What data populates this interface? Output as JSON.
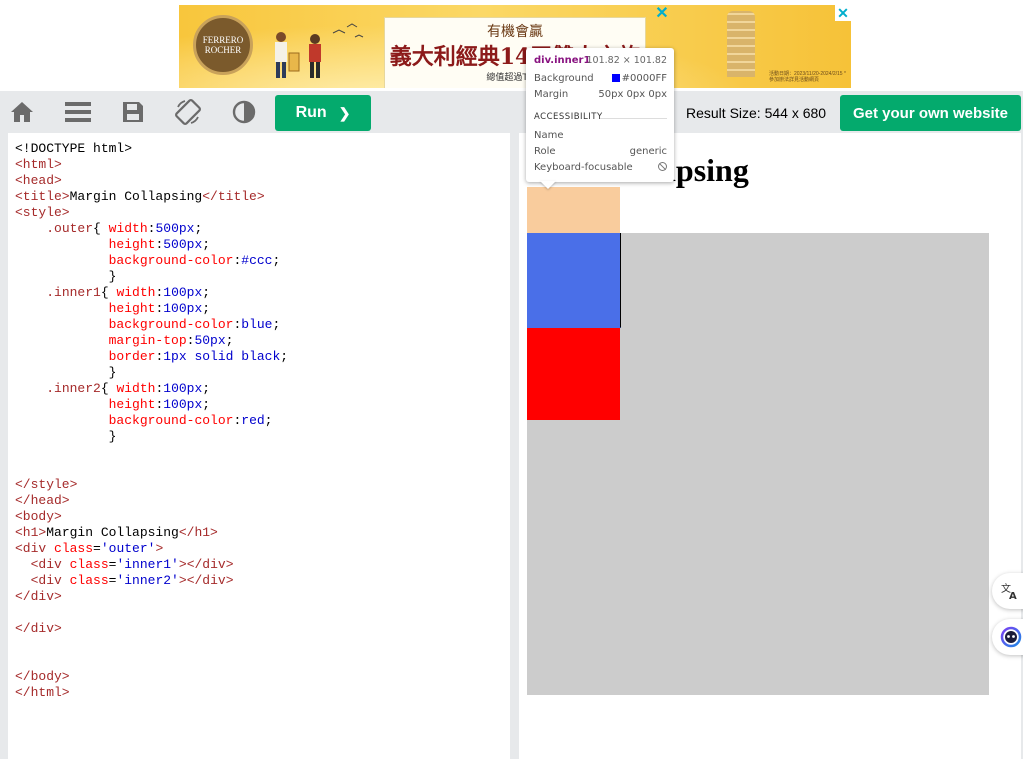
{
  "ad": {
    "logo_line1": "FERRERO",
    "logo_line2": "ROCHER",
    "subtitle": "有機會贏",
    "headline": "義大利經典14天雙人之旅",
    "footer": "總值超過TWD",
    "fine_print": "活動日期：2023/11/20-2024/2/15 *參加辦法詳見活動網頁",
    "close_glyph": "✕",
    "info_glyph": "✕"
  },
  "toolbar": {
    "home_icon": "home-icon",
    "menu_icon": "menu-icon",
    "save_icon": "save-icon",
    "rotate_icon": "rotate-icon",
    "contrast_icon": "contrast-icon",
    "run_label": "Run",
    "run_chevron": "❯",
    "result_size": "Result Size: 544 x 680",
    "get_website_label": "Get your own website"
  },
  "code_lines": {
    "l1": "<!DOCTYPE html>",
    "l2_tag": "<html>",
    "l3_tag": "<head>",
    "l4_open": "<title>",
    "l4_text": "Margin Collapsing",
    "l4_close": "</title>",
    "l5_tag": "<style>",
    "outer_sel": ".outer",
    "outer_w_prop": "width",
    "outer_w_val": "500px",
    "outer_h_prop": "height",
    "outer_h_val": "500px",
    "outer_bg_prop": "background-color",
    "outer_bg_val": "#ccc",
    "inner1_sel": ".inner1",
    "inner1_w_prop": "width",
    "inner1_w_val": "100px",
    "inner1_h_prop": "height",
    "inner1_h_val": "100px",
    "inner1_bg_prop": "background-color",
    "inner1_bg_val": "blue",
    "inner1_mt_prop": "margin-top",
    "inner1_mt_val": "50px",
    "inner1_b_prop": "border",
    "inner1_b_val": "1px solid black",
    "inner2_sel": ".inner2",
    "inner2_w_prop": "width",
    "inner2_w_val": "100px",
    "inner2_h_prop": "height",
    "inner2_h_val": "100px",
    "inner2_bg_prop": "background-color",
    "inner2_bg_val": "red",
    "style_close": "</style>",
    "head_close": "</head>",
    "body_open": "<body>",
    "h1_open": "<h1>",
    "h1_text": "Margin Collapsing",
    "h1_close": "</h1>",
    "div_open_pre": "<div ",
    "class_attr": "class",
    "outer_class_val": "'outer'",
    "inner1_class_val": "'inner1'",
    "inner2_class_val": "'inner2'",
    "gt": ">",
    "div_close": "</div>",
    "body_close": "</body>",
    "html_close": "</html>"
  },
  "result": {
    "h1_visible": "lapsing",
    "colors": {
      "outer": "#cccccc",
      "inner1": "#4a6fe8",
      "inner2": "#ff0000",
      "margin_highlight": "#f9cc9d"
    }
  },
  "tooltip": {
    "element": "div.inner1",
    "dimensions": "101.82 × 101.82",
    "background_label": "Background",
    "background_value": "#0000FF",
    "margin_label": "Margin",
    "margin_value": "50px 0px 0px",
    "section_title": "ACCESSIBILITY",
    "name_label": "Name",
    "role_label": "Role",
    "role_value": "generic",
    "focusable_label": "Keyboard-focusable"
  },
  "side_buttons": {
    "translate_icon": "translate-icon",
    "assistant_icon": "assistant-icon"
  }
}
